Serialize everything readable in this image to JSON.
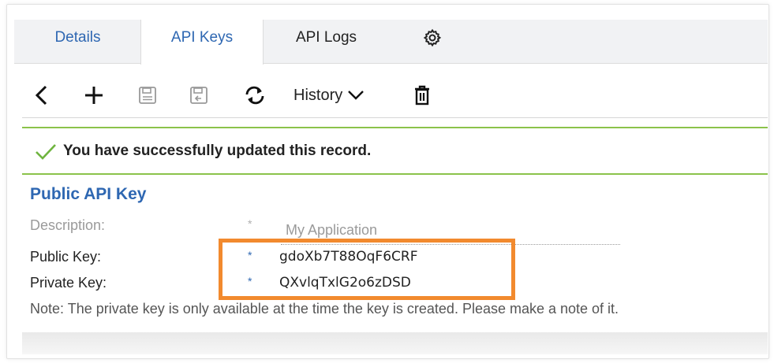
{
  "tabs": {
    "details": "Details",
    "api_keys": "API Keys",
    "api_logs": "API Logs",
    "settings_icon": "gear-icon"
  },
  "toolbar": {
    "back_icon": "chevron-left-icon",
    "add_icon": "plus-icon",
    "save_icon": "floppy-disk-icon",
    "save_close_icon": "floppy-disk-exit-icon",
    "refresh_icon": "refresh-icon",
    "history_label": "History",
    "history_icon": "chevron-down-icon",
    "delete_icon": "trash-icon"
  },
  "alert": {
    "icon": "check-icon",
    "message": "You have successfully updated this record.",
    "color": "#8bc34a"
  },
  "section": {
    "title": "Public API Key"
  },
  "fields": {
    "description_label": "Description:",
    "description_value": "My Application",
    "public_key_label": "Public Key:",
    "public_key_value": "gdoXb7T88OqF6CRF",
    "private_key_label": "Private Key:",
    "private_key_value": "QXvlqTxlG2o6zDSD",
    "required_marker": "*"
  },
  "note": "Note: The private key is only available at the time the key is created. Please make a note of it.",
  "colors": {
    "accent": "#2e67b2",
    "highlight": "#f28a2e",
    "success": "#8bc34a"
  }
}
